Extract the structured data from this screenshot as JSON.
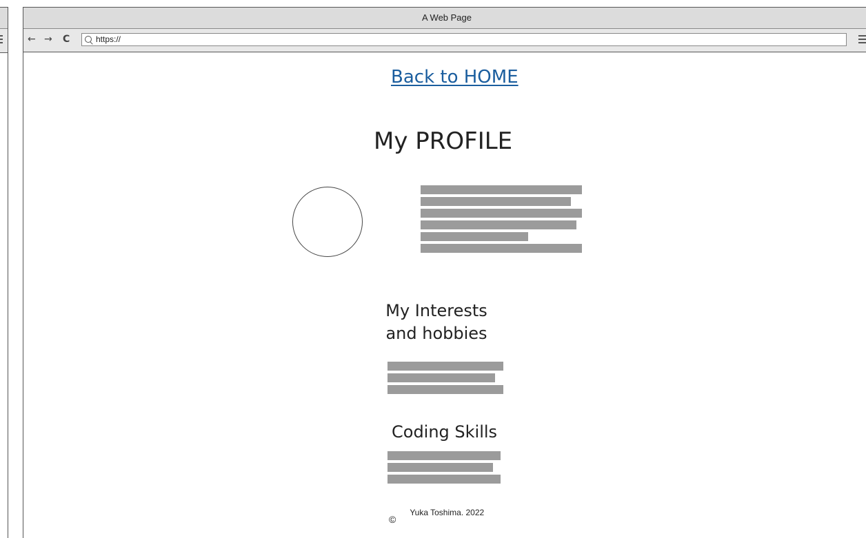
{
  "browser": {
    "title": "A Web Page",
    "back_glyph": "←",
    "forward_glyph": "→",
    "reload_glyph": "C",
    "url": "https://"
  },
  "page": {
    "back_link": "Back to HOME",
    "title": "My PROFILE",
    "interests_title_line1": "My Interests",
    "interests_title_line2": "and hobbies",
    "skills_title": "Coding Skills",
    "copyright_symbol": "©",
    "footer_text": "Yuka Toshima. 2022"
  },
  "colors": {
    "link": "#1a5d9e",
    "placeholder_bar": "#9b9b9b",
    "chrome": "#dcdcdc"
  }
}
